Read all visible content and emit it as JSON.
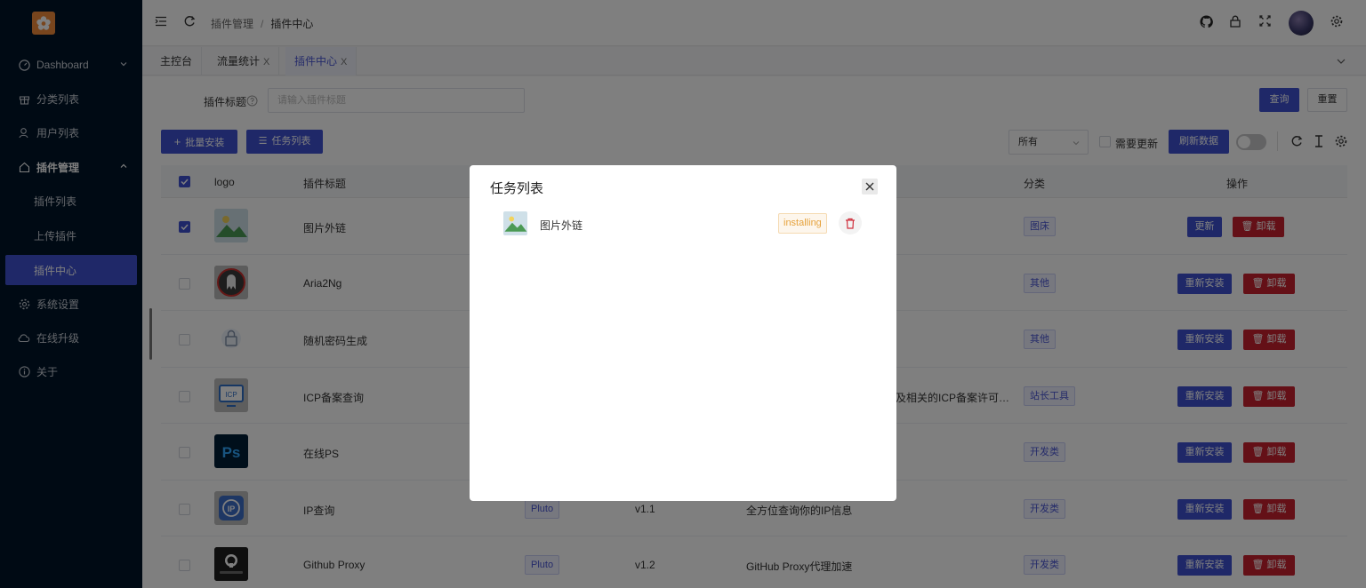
{
  "sidebar": {
    "items": [
      {
        "label": "Dashboard",
        "icon": "dashboard-icon"
      },
      {
        "label": "分类列表",
        "icon": "gift-icon"
      },
      {
        "label": "用户列表",
        "icon": "user-icon"
      },
      {
        "label": "插件管理",
        "icon": "home-icon"
      },
      {
        "label": "插件列表"
      },
      {
        "label": "上传插件"
      },
      {
        "label": "插件中心"
      },
      {
        "label": "系统设置",
        "icon": "gear-icon"
      },
      {
        "label": "在线升级",
        "icon": "cloud-icon"
      },
      {
        "label": "关于",
        "icon": "info-icon"
      }
    ]
  },
  "header": {
    "breadcrumb": [
      "插件管理",
      "插件中心"
    ],
    "separator": "/"
  },
  "tabs": [
    {
      "label": "主控台"
    },
    {
      "label": "流量统计",
      "close": "X"
    },
    {
      "label": "插件中心",
      "close": "X"
    }
  ],
  "search": {
    "label": "插件标题",
    "placeholder": "请输入插件标题",
    "query_btn": "查询",
    "reset_btn": "重置"
  },
  "toolbar": {
    "batch_install": "批量安装",
    "task_list": "任务列表",
    "filter_value": "所有",
    "need_update": "需要更新",
    "refresh_data": "刷新数据"
  },
  "table": {
    "headers": {
      "logo": "logo",
      "title": "插件标题",
      "category": "分类",
      "action": "操作"
    },
    "rows": [
      {
        "title": "图片外链",
        "tag": "",
        "version": "",
        "desc": "",
        "category": "图床",
        "primary": "更新",
        "danger": "卸载",
        "checked": true
      },
      {
        "title": "Aria2Ng",
        "tag": "",
        "version": "",
        "desc": "",
        "category": "其他",
        "primary": "重新安装",
        "danger": "卸载",
        "checked": false
      },
      {
        "title": "随机密码生成",
        "tag": "",
        "version": "",
        "desc": "",
        "category": "其他",
        "primary": "重新安装",
        "danger": "卸载",
        "checked": false
      },
      {
        "title": "ICP备案查询",
        "tag": "",
        "version": "",
        "desc": "及相关的ICP备案许可…",
        "category": "站长工具",
        "primary": "重新安装",
        "danger": "卸载",
        "checked": false
      },
      {
        "title": "在线PS",
        "tag": "",
        "version": "",
        "desc": "",
        "category": "开发类",
        "primary": "重新安装",
        "danger": "卸载",
        "checked": false
      },
      {
        "title": "IP查询",
        "tag": "Pluto",
        "version": "v1.1",
        "desc": "全方位查询你的IP信息",
        "category": "开发类",
        "primary": "重新安装",
        "danger": "卸载",
        "checked": false
      },
      {
        "title": "Github Proxy",
        "tag": "Pluto",
        "version": "v1.2",
        "desc": "GitHub Proxy代理加速",
        "category": "开发类",
        "primary": "重新安装",
        "danger": "卸载",
        "checked": false
      }
    ]
  },
  "modal": {
    "title": "任务列表",
    "tasks": [
      {
        "name": "图片外链",
        "status": "installing"
      }
    ]
  },
  "colors": {
    "sidebar_bg": "#001529",
    "primary": "#3f51d0",
    "danger": "#c8202e",
    "warning": "#e6a23c"
  }
}
